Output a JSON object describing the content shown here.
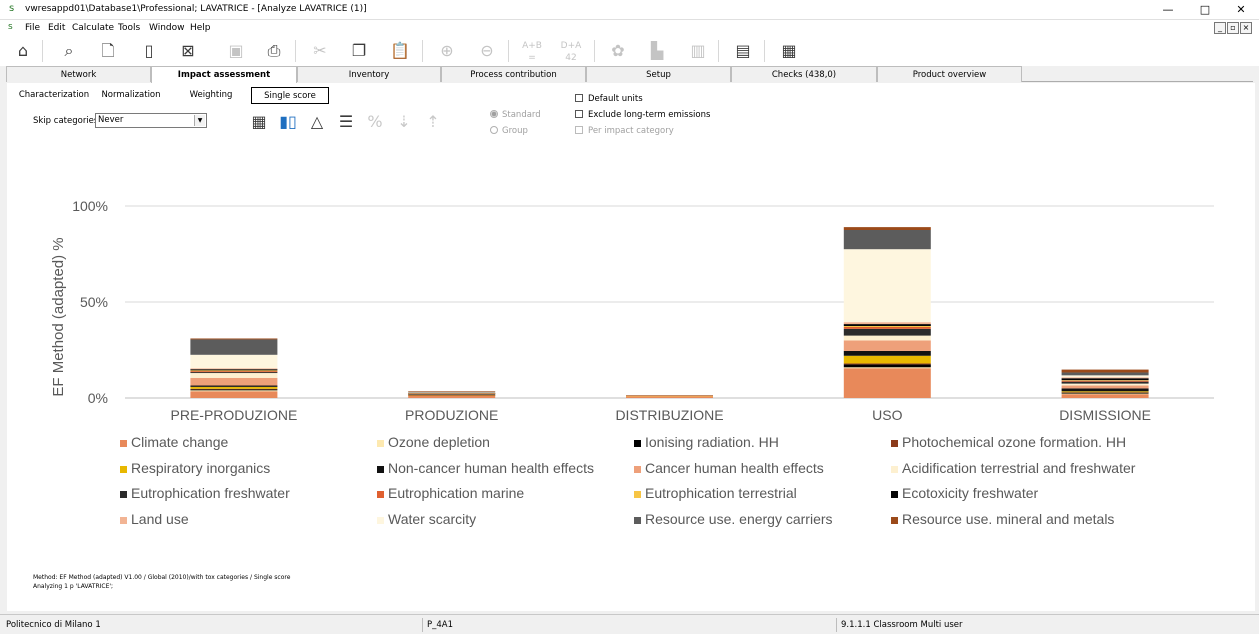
{
  "window": {
    "title": "vwresappd01\\Database1\\Professional; LAVATRICE - [Analyze LAVATRICE (1)]",
    "controls": [
      "—",
      "□",
      "✕"
    ]
  },
  "menu": {
    "items": [
      "File",
      "Edit",
      "Calculate",
      "Tools",
      "Window",
      "Help"
    ],
    "mdi_controls": [
      "_",
      "▫",
      "×"
    ]
  },
  "toolbar": {
    "ab_label": "A+B",
    "da_label": "D+A"
  },
  "main_tabs": [
    {
      "label": "Network"
    },
    {
      "label": "Impact assessment"
    },
    {
      "label": "Inventory"
    },
    {
      "label": "Process contribution"
    },
    {
      "label": "Setup"
    },
    {
      "label": "Checks (438,0)"
    },
    {
      "label": "Product overview"
    }
  ],
  "sub_tabs": [
    {
      "label": "Characterization"
    },
    {
      "label": "Normalization"
    },
    {
      "label": "Weighting"
    },
    {
      "label": "Single score"
    }
  ],
  "skip": {
    "label": "Skip categories",
    "value": "Never"
  },
  "options": {
    "standard": "Standard",
    "group": "Group",
    "default_units": "Default units",
    "exclude_long_term": "Exclude long-term emissions",
    "per_impact_category": "Per impact category"
  },
  "chart_data": {
    "type": "bar",
    "stacked": true,
    "ylabel": "EF Method (adapted) %",
    "yticks": [
      "100%",
      "50%",
      "0%"
    ],
    "ylim": [
      0,
      100
    ],
    "grid": true,
    "legend_position": "bottom",
    "categories": [
      "PRE-PRODUZIONE",
      "PRODUZIONE",
      "DISTRIBUZIONE",
      "USO",
      "DISMISSIONE"
    ],
    "series": [
      {
        "name": "Climate change",
        "color": "#e8895a",
        "values": [
          3.5,
          1.5,
          0.8,
          15.5,
          2.0
        ]
      },
      {
        "name": "Ozone depletion",
        "color": "#fde9b0",
        "values": [
          0.5,
          0,
          0,
          0.5,
          0.3
        ]
      },
      {
        "name": "Ionising radiation. HH",
        "color": "#000000",
        "values": [
          0.5,
          0,
          0,
          1.5,
          0.5
        ]
      },
      {
        "name": "Photochemical ozone formation. HH",
        "color": "#8b3a1a",
        "values": [
          0.3,
          0.1,
          0,
          0.5,
          0.2
        ]
      },
      {
        "name": "Respiratory inorganics",
        "color": "#e8b800",
        "values": [
          1.0,
          0.1,
          0.1,
          4.0,
          0.5
        ]
      },
      {
        "name": "Non-cancer human health effects",
        "color": "#111111",
        "values": [
          0.7,
          0.1,
          0,
          2.5,
          1.5
        ]
      },
      {
        "name": "Cancer human health effects",
        "color": "#eea07a",
        "values": [
          4.0,
          0.3,
          0.1,
          5.5,
          1.5
        ]
      },
      {
        "name": "Acidification terrestrial and freshwater",
        "color": "#fdf0d0",
        "values": [
          2.5,
          0.1,
          0.1,
          2.5,
          1.0
        ]
      },
      {
        "name": "Eutrophication freshwater",
        "color": "#2b2b2b",
        "values": [
          0.5,
          0.1,
          0,
          3.5,
          1.0
        ]
      },
      {
        "name": "Eutrophication marine",
        "color": "#e06030",
        "values": [
          0.5,
          0.1,
          0.1,
          1.0,
          0.5
        ]
      },
      {
        "name": "Eutrophication terrestrial",
        "color": "#f7c545",
        "values": [
          0.4,
          0.1,
          0,
          0.5,
          0.3
        ]
      },
      {
        "name": "Ecotoxicity freshwater",
        "color": "#050505",
        "values": [
          0.6,
          0.1,
          0,
          1.0,
          1.0
        ]
      },
      {
        "name": "Land use",
        "color": "#f2b494",
        "values": [
          0.5,
          0.1,
          0.1,
          1.0,
          0.5
        ]
      },
      {
        "name": "Water scarcity",
        "color": "#fef6df",
        "values": [
          7.0,
          0.2,
          0.1,
          38.0,
          1.0
        ]
      },
      {
        "name": "Resource use. energy carriers",
        "color": "#5c5c5c",
        "values": [
          8.0,
          0.3,
          0,
          10.0,
          1.5
        ]
      },
      {
        "name": "Resource use. mineral and metals",
        "color": "#9b4a1a",
        "values": [
          0.5,
          0.3,
          0.1,
          1.5,
          1.5
        ]
      }
    ]
  },
  "method": {
    "line1": "Method: EF Method (adapted) V1.00 / Global (2010)/with tox categories / Single score",
    "line2": "Analyzing 1 p 'LAVATRICE';"
  },
  "status": {
    "org": "Politecnico di Milano 1",
    "code": "P_4A1",
    "version": "9.1.1.1 Classroom Multi user"
  }
}
